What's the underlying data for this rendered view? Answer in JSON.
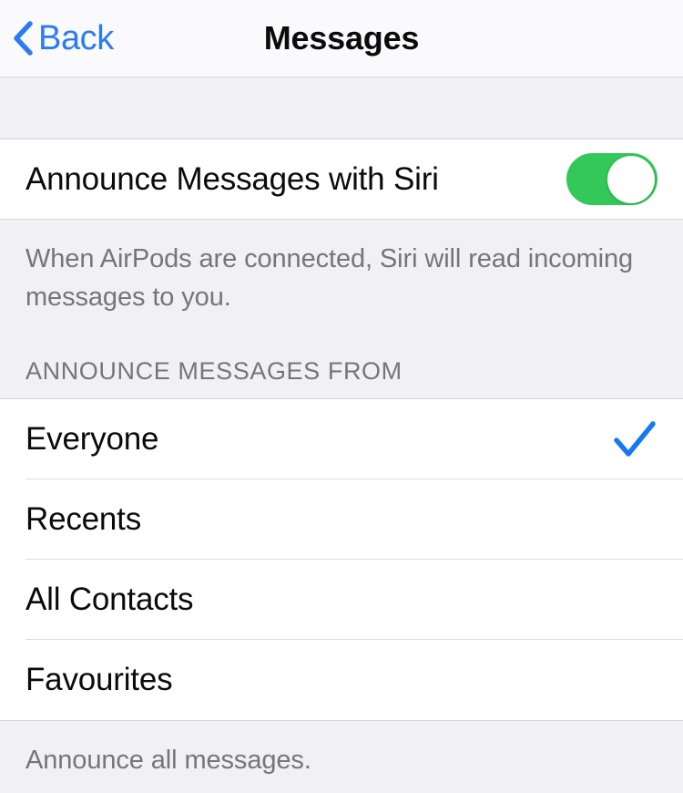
{
  "navbar": {
    "back_label": "Back",
    "back_icon": "chevron-left-icon",
    "title": "Messages"
  },
  "announce_toggle": {
    "label": "Announce Messages with Siri",
    "state": "on",
    "state_color": "#34C759",
    "footnote": "When AirPods are connected, Siri will read incoming messages to you."
  },
  "announce_from": {
    "section_title": "ANNOUNCE MESSAGES FROM",
    "options": [
      {
        "label": "Everyone",
        "selected": true
      },
      {
        "label": "Recents",
        "selected": false
      },
      {
        "label": "All Contacts",
        "selected": false
      },
      {
        "label": "Favourites",
        "selected": false
      }
    ],
    "checkmark_icon": "checkmark-icon",
    "checkmark_color": "#1878F0",
    "footnote": "Announce all messages."
  },
  "colors": {
    "accent_blue": "#2B7BF6",
    "group_background": "#F1F1F5",
    "cell_background": "#FFFFFF",
    "secondary_text": "#75757A"
  }
}
